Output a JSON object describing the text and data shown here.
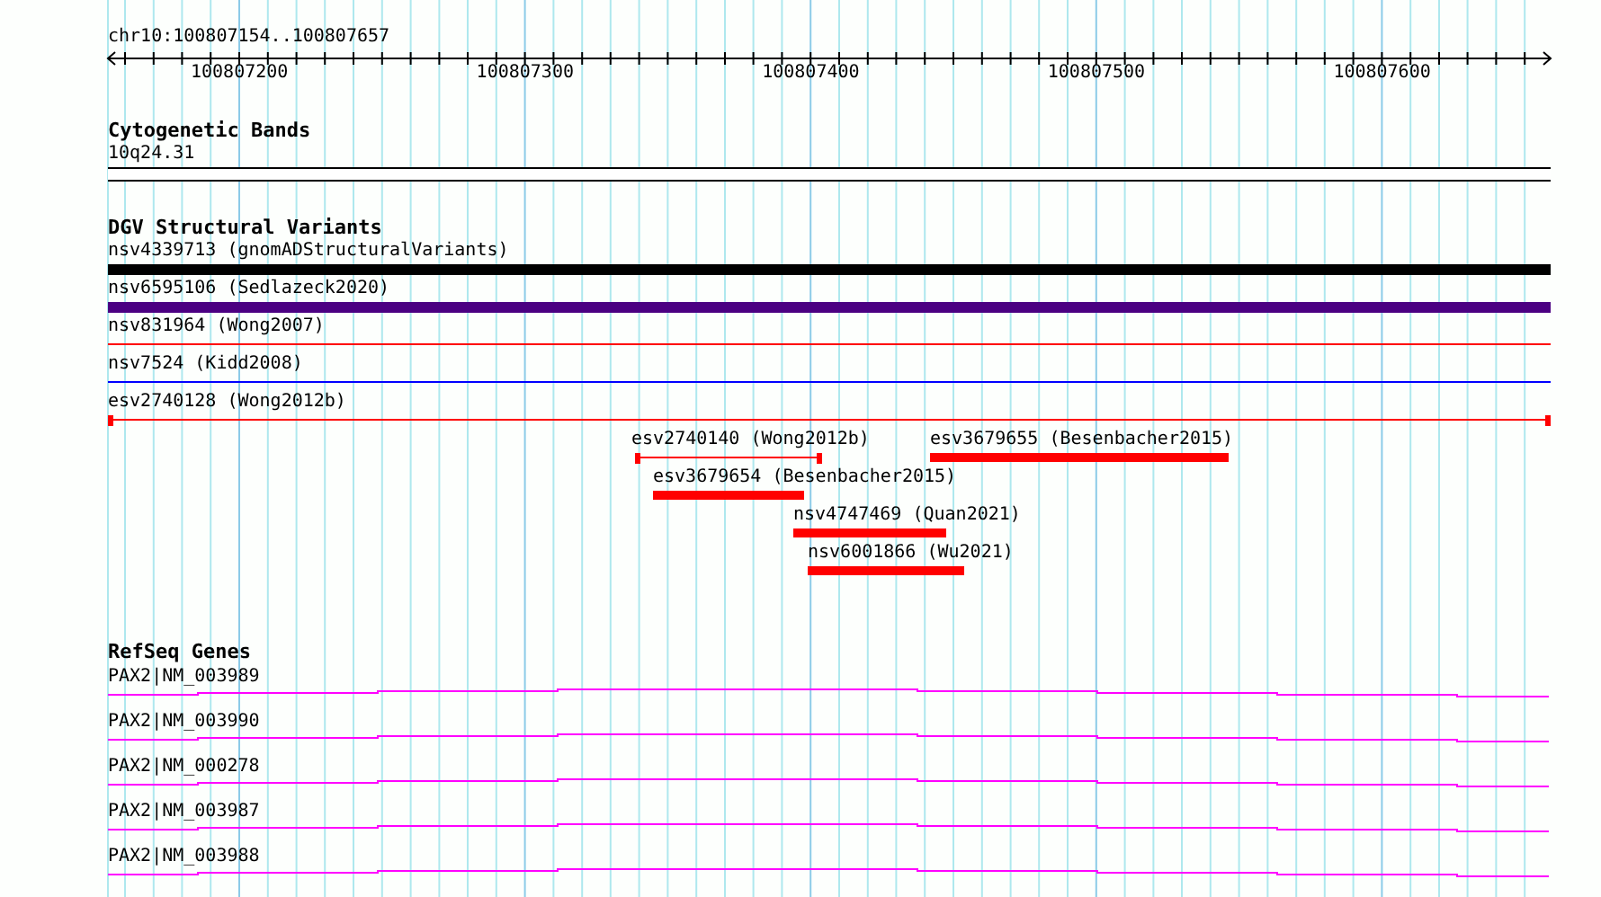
{
  "ruler": {
    "location": "chr10:100807154..100807657",
    "tick_labels": [
      "100807200",
      "100807300",
      "100807400",
      "100807500",
      "100807600"
    ]
  },
  "tracks": [
    {
      "kind": "bands",
      "title": "Cytogenetic Bands",
      "features": [
        {
          "label": "10q24.31"
        }
      ]
    },
    {
      "kind": "variants",
      "title": "DGV Structural Variants",
      "features": [
        {
          "label": "nsv4339713 (gnomADStructuralVariants)",
          "kind": "bar",
          "color": "#000000"
        },
        {
          "label": "nsv6595106 (Sedlazeck2020)",
          "kind": "bar",
          "color": "#4b0082"
        },
        {
          "label": "nsv831964 (Wong2007)",
          "kind": "line",
          "color": "#ff0000"
        },
        {
          "label": "nsv7524 (Kidd2008)",
          "kind": "line",
          "color": "#0000ff"
        },
        {
          "label": "esv2740128 (Wong2012b)",
          "kind": "capped",
          "color": "#ff0000"
        },
        {
          "label": "esv2740140 (Wong2012b)",
          "kind": "capped",
          "color": "#ff0000"
        },
        {
          "label": "esv3679655 (Besenbacher2015)",
          "kind": "bar",
          "color": "#ff0000"
        },
        {
          "label": "esv3679654 (Besenbacher2015)",
          "kind": "bar",
          "color": "#ff0000"
        },
        {
          "label": "nsv4747469 (Quan2021)",
          "kind": "bar",
          "color": "#ff0000"
        },
        {
          "label": "nsv6001866 (Wu2021)",
          "kind": "bar",
          "color": "#ff0000"
        }
      ]
    },
    {
      "kind": "genes",
      "title": "RefSeq Genes",
      "features": [
        {
          "label": "PAX2|NM_003989"
        },
        {
          "label": "PAX2|NM_003990"
        },
        {
          "label": "PAX2|NM_000278"
        },
        {
          "label": "PAX2|NM_003987"
        },
        {
          "label": "PAX2|NM_003988"
        }
      ]
    }
  ]
}
